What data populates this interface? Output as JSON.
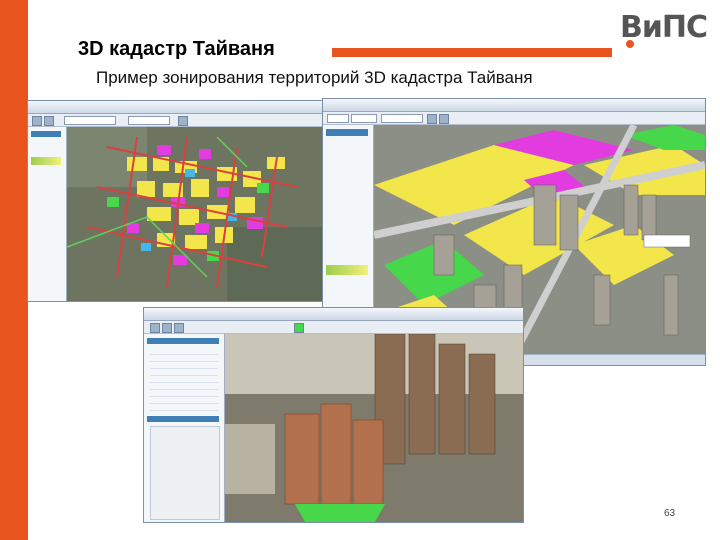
{
  "slide": {
    "title": "3D кадастр Тайваня",
    "subtitle": "Пример зонирования территорий 3D кадастра Тайваня",
    "page_number": "63",
    "logo_text": "ВиПС",
    "accent_color": "#e8541e"
  },
  "screenshots": [
    {
      "id": "map-2d",
      "view": "2d-zoning-map"
    },
    {
      "id": "map-3d",
      "view": "3d-zoning-view"
    },
    {
      "id": "map-3d-detail",
      "view": "3d-building-detail"
    }
  ],
  "zone_colors": {
    "residential": "#f2e64a",
    "commercial": "#e23ce0",
    "green": "#46d84a",
    "road": "#d94040",
    "public": "#45b6e8"
  }
}
